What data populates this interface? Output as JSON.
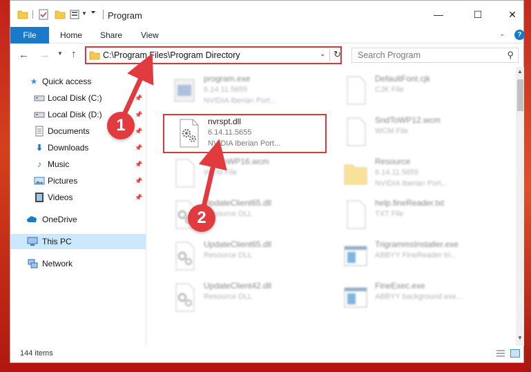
{
  "window": {
    "title": "Program",
    "minimize_glyph": "—",
    "maximize_glyph": "☐",
    "close_glyph": "✕"
  },
  "ribbon": {
    "file_label": "File",
    "home_label": "Home",
    "share_label": "Share",
    "view_label": "View",
    "help_glyph": "?"
  },
  "navbar": {
    "address": "C:\\Program Files\\Program Directory",
    "search_placeholder": "Search Program"
  },
  "sidebar": {
    "items": [
      {
        "label": "Quick access",
        "icon": "star-icon",
        "pinned": false
      },
      {
        "label": "Local Disk (C:)",
        "icon": "drive-icon",
        "pinned": true
      },
      {
        "label": "Local Disk (D:)",
        "icon": "drive-icon",
        "pinned": true
      },
      {
        "label": "Documents",
        "icon": "documents-icon",
        "pinned": true
      },
      {
        "label": "Downloads",
        "icon": "download-icon",
        "pinned": true
      },
      {
        "label": "Music",
        "icon": "music-icon",
        "pinned": true
      },
      {
        "label": "Pictures",
        "icon": "pictures-icon",
        "pinned": true
      },
      {
        "label": "Videos",
        "icon": "videos-icon",
        "pinned": true
      },
      {
        "label": "OneDrive",
        "icon": "cloud-icon",
        "pinned": false
      },
      {
        "label": "This PC",
        "icon": "computer-icon",
        "pinned": false,
        "selected": true
      },
      {
        "label": "Network",
        "icon": "network-icon",
        "pinned": false
      }
    ]
  },
  "files": [
    {
      "name": "program.exe",
      "line2": "6.14.11.5655",
      "line3": "NVIDIA Iberian Port...",
      "icon": "exe-icon",
      "blurred": true
    },
    {
      "name": "DefaultFont.cjk",
      "line2": "CJK File",
      "line3": "",
      "icon": "blank-file-icon",
      "blurred": true
    },
    {
      "name": "nvrspt.dll",
      "line2": "6.14.11.5655",
      "line3": "NVIDIA Iberian Port...",
      "icon": "dll-gear-icon",
      "blurred": false,
      "highlighted": true
    },
    {
      "name": "SndToWP12.wcm",
      "line2": "WCM File",
      "line3": "",
      "icon": "blank-file-icon",
      "blurred": true
    },
    {
      "name": "SndToWP16.wcm",
      "line2": "WCM File",
      "line3": "",
      "icon": "blank-file-icon",
      "blurred": true
    },
    {
      "name": "Resource",
      "line2": "6.14.11.5655",
      "line3": "NVIDIA Iberian Port...",
      "icon": "folder-icon",
      "blurred": true
    },
    {
      "name": "UpdateClient65.dll",
      "line2": "Resource DLL",
      "line3": "",
      "icon": "dll-gear-icon",
      "blurred": true
    },
    {
      "name": "help.fineReader.txt",
      "line2": "TXT File",
      "line3": "",
      "icon": "blank-file-icon",
      "blurred": true
    },
    {
      "name": "UpdateClient65.dll",
      "line2": "Resource DLL",
      "line3": "",
      "icon": "dll-gear-icon",
      "blurred": true
    },
    {
      "name": "TrigrammsInstaller.exe",
      "line2": "ABBYY FineReader tri...",
      "line3": "",
      "icon": "app-window-icon",
      "blurred": true
    },
    {
      "name": "UpdateClient42.dll",
      "line2": "Resource DLL",
      "line3": "",
      "icon": "dll-gear-icon",
      "blurred": true
    },
    {
      "name": "FineExec.exe",
      "line2": "ABBYY background exe...",
      "line3": "",
      "icon": "app-window-icon",
      "blurred": true
    }
  ],
  "status": {
    "item_count": "144 items"
  },
  "annotations": {
    "step1": "1",
    "step2": "2"
  },
  "colors": {
    "accent": "#1979ca",
    "highlight_red": "#d9373a",
    "badge_red": "#e23b3f",
    "selected_bg": "#cce8ff"
  }
}
